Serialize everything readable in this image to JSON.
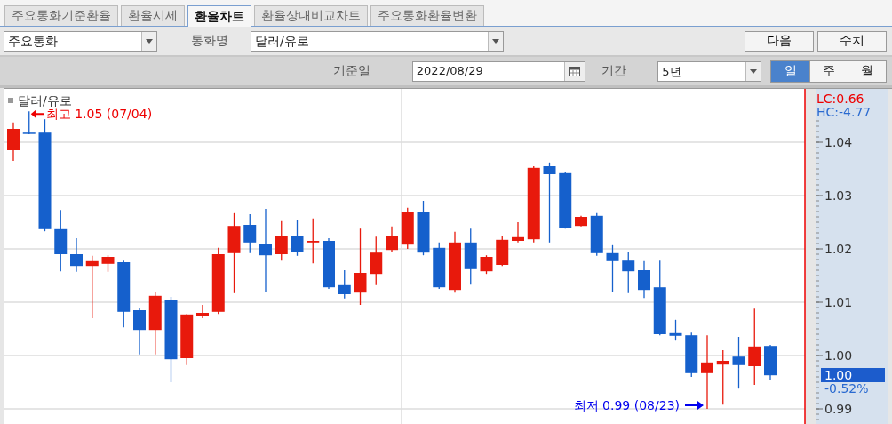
{
  "tabs": [
    {
      "label": "주요통화기준환율",
      "selected": false
    },
    {
      "label": "환율시세",
      "selected": false
    },
    {
      "label": "환율차트",
      "selected": true
    },
    {
      "label": "환율상대비교차트",
      "selected": false
    },
    {
      "label": "주요통화환율변환",
      "selected": false
    }
  ],
  "filter_bar": {
    "group_select": {
      "value": "주요통화"
    },
    "currency_label": "통화명",
    "currency_select": {
      "value": "달러/유로"
    },
    "buttons": [
      "다음",
      "수치"
    ]
  },
  "date_bar": {
    "date_label": "기준일",
    "date_field": {
      "value": "2022/08/29"
    },
    "period_label": "기간",
    "period_select": {
      "value": "5년"
    },
    "intervals": [
      {
        "label": "일",
        "selected": true
      },
      {
        "label": "주",
        "selected": false
      },
      {
        "label": "월",
        "selected": false
      }
    ]
  },
  "chart": {
    "lc": "LC:0.66",
    "hc": "HC:-4.77",
    "current_price": "1.00",
    "change": "-0.52%",
    "chart_data": {
      "type": "candlestick",
      "title": "달러/유로",
      "grid": true,
      "ylim": [
        0.987,
        1.05
      ],
      "yticks": [
        {
          "value": 1.04,
          "label": "1.04"
        },
        {
          "value": 1.03,
          "label": "1.03"
        },
        {
          "value": 1.02,
          "label": "1.02"
        },
        {
          "value": 1.01,
          "label": "1.01"
        },
        {
          "value": 1.0,
          "label": "1.00"
        },
        {
          "value": 0.99,
          "label": "0.99"
        }
      ],
      "ohlc": [
        [
          1.0385,
          1.0437,
          1.0365,
          1.0425
        ],
        [
          1.0418,
          1.0458,
          1.0415,
          1.0417
        ],
        [
          1.0418,
          1.0443,
          1.0233,
          1.0237
        ],
        [
          1.0237,
          1.0273,
          1.0158,
          1.019
        ],
        [
          1.019,
          1.022,
          1.0157,
          1.0168
        ],
        [
          1.0168,
          1.0187,
          1.007,
          1.0177
        ],
        [
          1.0172,
          1.0188,
          1.0157,
          1.0185
        ],
        [
          1.0175,
          1.0178,
          1.0053,
          1.0082
        ],
        [
          1.0085,
          1.009,
          1.0002,
          1.0048
        ],
        [
          1.0048,
          1.012,
          1.0002,
          1.0112
        ],
        [
          1.0105,
          1.011,
          0.995,
          0.9993
        ],
        [
          0.9995,
          1.0078,
          0.9982,
          1.0077
        ],
        [
          1.0075,
          1.0095,
          1.007,
          1.008
        ],
        [
          1.0082,
          1.0202,
          1.0078,
          1.019
        ],
        [
          1.0192,
          1.0267,
          1.0117,
          1.0243
        ],
        [
          1.0245,
          1.0265,
          1.0192,
          1.0212
        ],
        [
          1.021,
          1.0275,
          1.012,
          1.0188
        ],
        [
          1.019,
          1.0252,
          1.0178,
          1.0225
        ],
        [
          1.0225,
          1.0255,
          1.0187,
          1.0195
        ],
        [
          1.0212,
          1.0257,
          1.0173,
          1.0215
        ],
        [
          1.0215,
          1.022,
          1.0125,
          1.0128
        ],
        [
          1.0132,
          1.016,
          1.0107,
          1.0115
        ],
        [
          1.0118,
          1.0238,
          1.0095,
          1.0155
        ],
        [
          1.0153,
          1.0223,
          1.0132,
          1.0193
        ],
        [
          1.0198,
          1.0242,
          1.0195,
          1.0225
        ],
        [
          1.0208,
          1.0277,
          1.02,
          1.027
        ],
        [
          1.027,
          1.029,
          1.0188,
          1.0193
        ],
        [
          1.0202,
          1.0212,
          1.0125,
          1.0128
        ],
        [
          1.0123,
          1.0232,
          1.0118,
          1.0212
        ],
        [
          1.0212,
          1.0238,
          1.0133,
          1.0162
        ],
        [
          1.0158,
          1.0188,
          1.0153,
          1.0185
        ],
        [
          1.017,
          1.0225,
          1.0168,
          1.0217
        ],
        [
          1.0215,
          1.025,
          1.0212,
          1.0222
        ],
        [
          1.0218,
          1.0355,
          1.0212,
          1.0352
        ],
        [
          1.0355,
          1.0362,
          1.0212,
          1.034
        ],
        [
          1.0342,
          1.0345,
          1.0238,
          1.024
        ],
        [
          1.0243,
          1.0262,
          1.0242,
          1.026
        ],
        [
          1.0262,
          1.0267,
          1.0187,
          1.0192
        ],
        [
          1.0192,
          1.0207,
          1.012,
          1.0177
        ],
        [
          1.0178,
          1.0195,
          1.0117,
          1.0158
        ],
        [
          1.016,
          1.0177,
          1.0108,
          1.0123
        ],
        [
          1.0128,
          1.0178,
          1.0038,
          1.004
        ],
        [
          1.0042,
          1.0067,
          1.0028,
          1.0037
        ],
        [
          1.0038,
          1.0043,
          0.996,
          0.9967
        ],
        [
          0.9967,
          1.0038,
          0.99,
          0.9987
        ],
        [
          0.9983,
          1.001,
          0.9908,
          0.999
        ],
        [
          0.9998,
          1.0035,
          0.9938,
          0.9982
        ],
        [
          0.998,
          1.0088,
          0.9945,
          1.0017
        ],
        [
          1.0018,
          1.002,
          0.9955,
          0.9963
        ]
      ],
      "annotations": [
        "최고 1.05 (07/04)",
        "최저 0.99 (08/23)"
      ]
    }
  }
}
